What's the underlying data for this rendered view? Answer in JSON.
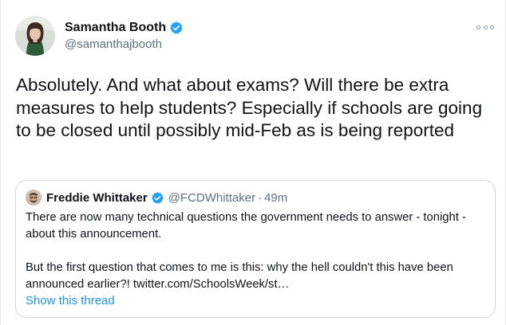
{
  "tweet": {
    "author_name": "Samantha Booth",
    "author_handle": "@samanthajbooth",
    "text": "Absolutely. And what about exams? Will there be extra measures to help students? Especially if schools are going to be closed until possibly mid-Feb as is being reported"
  },
  "quote": {
    "author_name": "Freddie Whittaker",
    "author_handle": "@FCDWhittaker",
    "separator": "·",
    "time": "49m",
    "paragraph1": "There are now many technical questions the government needs to answer - tonight - about this announcement.",
    "paragraph2_text": "But the first question that comes to me is this: why the hell couldn't this have been announced earlier?! ",
    "paragraph2_link": "twitter.com/SchoolsWeek/st…",
    "show_thread": "Show this thread"
  },
  "icons": {
    "verified": "verified-badge-icon",
    "more": "more-options-icon"
  },
  "colors": {
    "verified_blue": "#1da1f2",
    "link_blue": "#1b95e0",
    "secondary_text": "#5b7083"
  }
}
